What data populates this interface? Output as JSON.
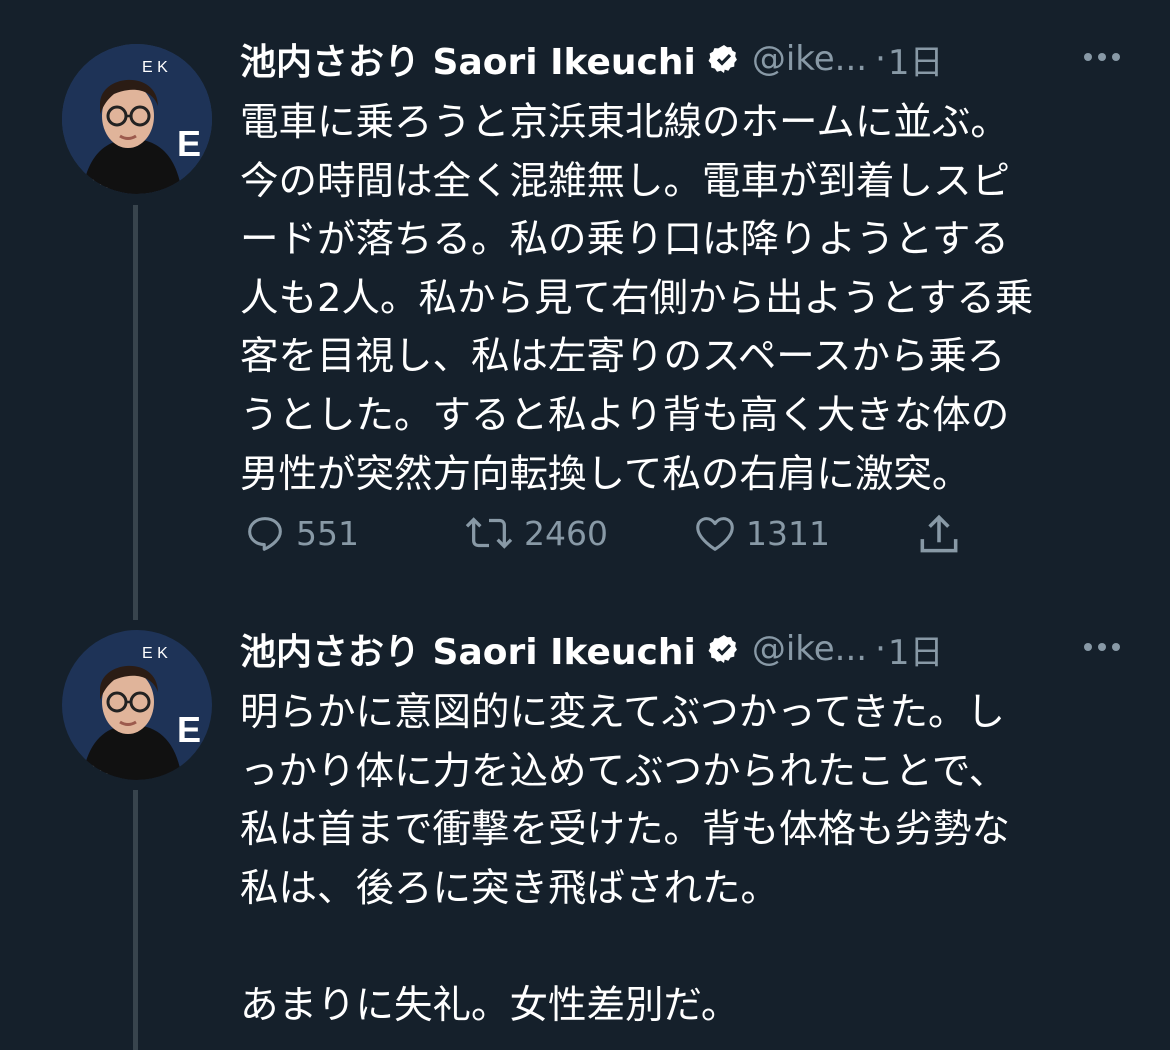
{
  "tweets": [
    {
      "author_name": "池内さおり Saori Ikeuchi",
      "handle": "@ike...",
      "separator": "·",
      "time": "1日",
      "text": "電車に乗ろうと京浜東北線のホームに並ぶ。\n今の時間は全く混雑無し。電車が到着しスピ\nードが落ちる。私の乗り口は降りようとする\n人も2人。私から見て右側から出ようとする乗\n客を目視し、私は左寄りのスペースから乗ろ\nうとした。すると私より背も高く大きな体の\n男性が突然方向転換して私の右肩に激突。",
      "actions": {
        "reply_count": "551",
        "retweet_count": "2460",
        "like_count": "1311"
      }
    },
    {
      "author_name": "池内さおり Saori Ikeuchi",
      "handle": "@ike...",
      "separator": "·",
      "time": "1日",
      "text": "明らかに意図的に変えてぶつかってきた。し\nっかり体に力を込めてぶつかられたことで、\n私は首まで衝撃を受けた。背も体格も劣勢な\n私は、後ろに突き飛ばされた。\n\nあまりに失礼。女性差別だ。"
    }
  ],
  "colors": {
    "background": "#15202b",
    "text": "#ffffff",
    "secondary": "#8899a6",
    "thread_line": "#38444d"
  },
  "icons": [
    "verified-badge-icon",
    "more-icon",
    "reply-icon",
    "retweet-icon",
    "like-icon",
    "share-icon"
  ]
}
